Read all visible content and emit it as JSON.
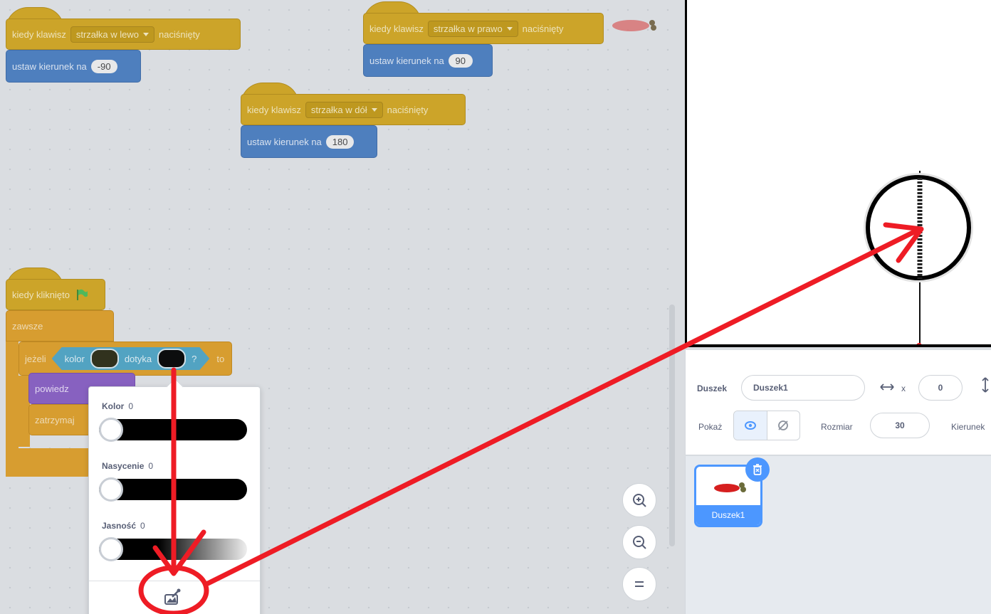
{
  "blocks": {
    "left_key": {
      "when_key": "kiedy klawisz",
      "key": "strzałka w lewo",
      "pressed": "naciśnięty",
      "set_dir": "ustaw kierunek na",
      "value": "-90"
    },
    "right_key": {
      "when_key": "kiedy klawisz",
      "key": "strzałka w prawo",
      "pressed": "naciśnięty",
      "set_dir": "ustaw kierunek na",
      "value": "90"
    },
    "down_key": {
      "when_key": "kiedy klawisz",
      "key": "strzałka w dół",
      "pressed": "naciśnięty",
      "set_dir": "ustaw kierunek na",
      "value": "180"
    },
    "flag": {
      "when_flag": "kiedy kliknięto",
      "forever": "zawsze",
      "if": "jeżeli",
      "color": "kolor",
      "touches": "dotyka",
      "q": "?",
      "then": "to",
      "say": "powiedz",
      "stop": "zatrzymaj"
    }
  },
  "picker": {
    "kolor_label": "Kolor",
    "kolor_value": "0",
    "nasycenie_label": "Nasycenie",
    "nasycenie_value": "0",
    "jasnosc_label": "Jasność",
    "jasnosc_value": "0"
  },
  "sprite_info": {
    "sprite_label": "Duszek",
    "sprite_name": "Duszek1",
    "x_label": "x",
    "x_value": "0",
    "show_label": "Pokaż",
    "size_label": "Rozmiar",
    "size_value": "30",
    "direction_label": "Kierunek"
  },
  "sprite_list": [
    {
      "name": "Duszek1",
      "selected": true
    }
  ],
  "colors": {
    "annotation": "#ee1c25",
    "accent": "#4c97ff",
    "event": "#d6a91f",
    "motion": "#4a7fc4"
  }
}
